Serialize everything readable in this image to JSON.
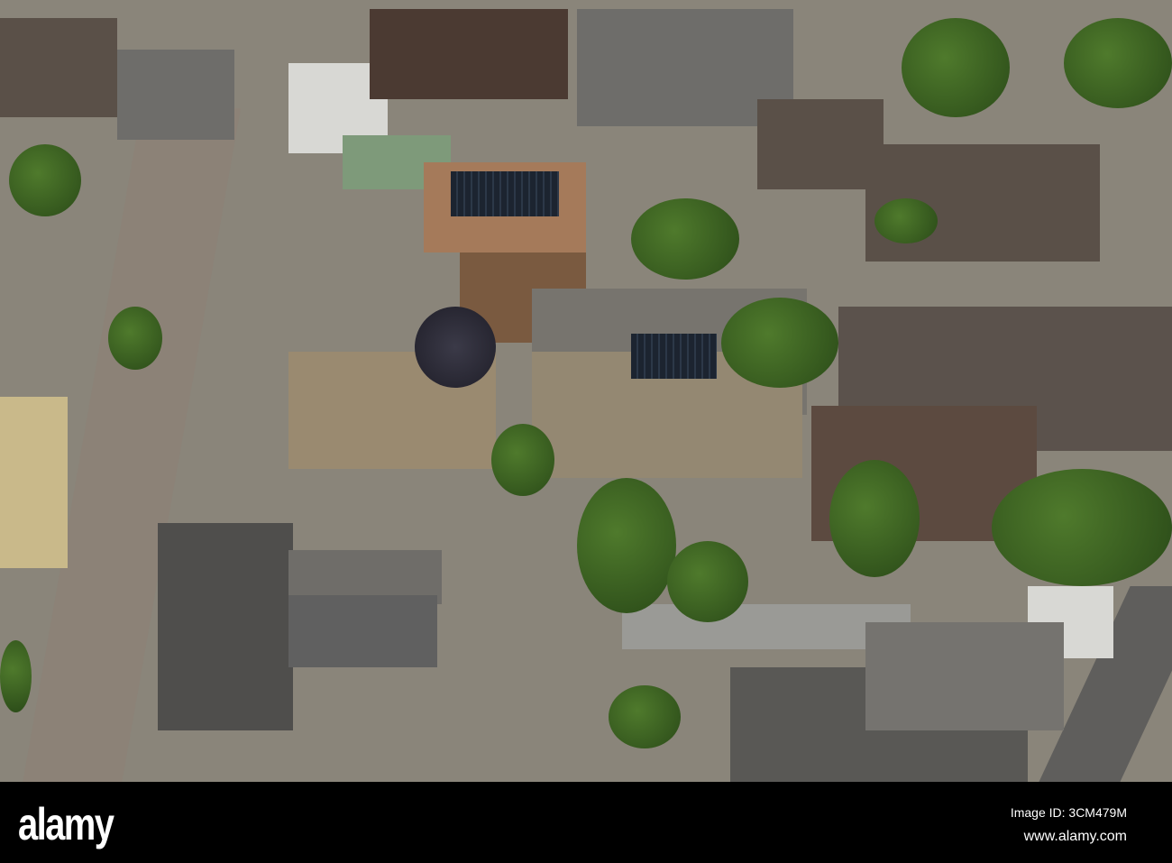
{
  "photo": {
    "description_label": "aerial-city-block"
  },
  "watermark": {
    "logo": "alamy",
    "image_id": "Image ID: 3CM479M",
    "url": "www.alamy.com"
  }
}
